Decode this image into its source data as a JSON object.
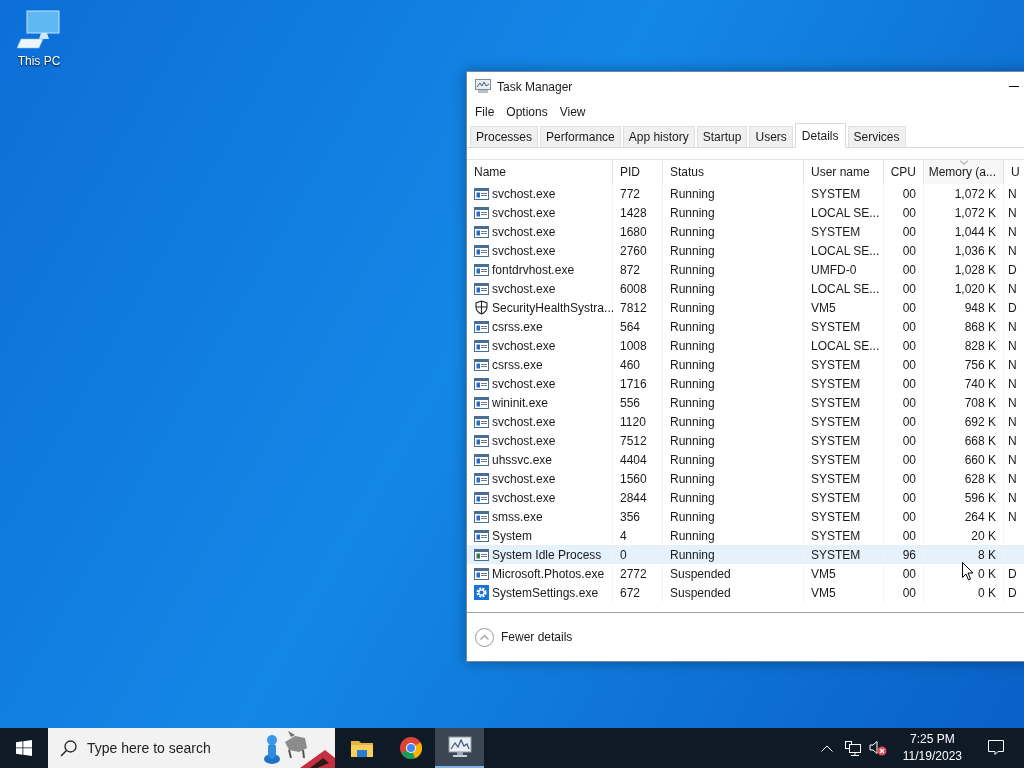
{
  "desktop": {
    "icons": [
      {
        "label": "This PC"
      }
    ]
  },
  "window": {
    "title": "Task Manager",
    "menu": [
      "File",
      "Options",
      "View"
    ],
    "tabs": [
      {
        "label": "Processes",
        "selected": false
      },
      {
        "label": "Performance",
        "selected": false
      },
      {
        "label": "App history",
        "selected": false
      },
      {
        "label": "Startup",
        "selected": false
      },
      {
        "label": "Users",
        "selected": false
      },
      {
        "label": "Details",
        "selected": true
      },
      {
        "label": "Services",
        "selected": false
      }
    ],
    "table": {
      "columns": [
        {
          "label": "Name",
          "sorted": false
        },
        {
          "label": "PID",
          "sorted": false
        },
        {
          "label": "Status",
          "sorted": false
        },
        {
          "label": "User name",
          "sorted": false
        },
        {
          "label": "CPU",
          "sorted": false
        },
        {
          "label": "Memory (a...",
          "sorted": true
        },
        {
          "label": "U",
          "sorted": false
        }
      ],
      "rows": [
        {
          "kind": "app",
          "selected": false,
          "cells": [
            "svchost.exe",
            "772",
            "Running",
            "SYSTEM",
            "00",
            "1,072 K",
            "N"
          ]
        },
        {
          "kind": "app",
          "selected": false,
          "cells": [
            "svchost.exe",
            "1428",
            "Running",
            "LOCAL SE...",
            "00",
            "1,072 K",
            "N"
          ]
        },
        {
          "kind": "app",
          "selected": false,
          "cells": [
            "svchost.exe",
            "1680",
            "Running",
            "SYSTEM",
            "00",
            "1,044 K",
            "N"
          ]
        },
        {
          "kind": "app",
          "selected": false,
          "cells": [
            "svchost.exe",
            "2760",
            "Running",
            "LOCAL SE...",
            "00",
            "1,036 K",
            "N"
          ]
        },
        {
          "kind": "app",
          "selected": false,
          "cells": [
            "fontdrvhost.exe",
            "872",
            "Running",
            "UMFD-0",
            "00",
            "1,028 K",
            "D"
          ]
        },
        {
          "kind": "app",
          "selected": false,
          "cells": [
            "svchost.exe",
            "6008",
            "Running",
            "LOCAL SE...",
            "00",
            "1,020 K",
            "N"
          ]
        },
        {
          "kind": "shield",
          "selected": false,
          "cells": [
            "SecurityHealthSystra...",
            "7812",
            "Running",
            "VM5",
            "00",
            "948 K",
            "D"
          ]
        },
        {
          "kind": "app",
          "selected": false,
          "cells": [
            "csrss.exe",
            "564",
            "Running",
            "SYSTEM",
            "00",
            "868 K",
            "N"
          ]
        },
        {
          "kind": "app",
          "selected": false,
          "cells": [
            "svchost.exe",
            "1008",
            "Running",
            "LOCAL SE...",
            "00",
            "828 K",
            "N"
          ]
        },
        {
          "kind": "app",
          "selected": false,
          "cells": [
            "csrss.exe",
            "460",
            "Running",
            "SYSTEM",
            "00",
            "756 K",
            "N"
          ]
        },
        {
          "kind": "app",
          "selected": false,
          "cells": [
            "svchost.exe",
            "1716",
            "Running",
            "SYSTEM",
            "00",
            "740 K",
            "N"
          ]
        },
        {
          "kind": "app",
          "selected": false,
          "cells": [
            "wininit.exe",
            "556",
            "Running",
            "SYSTEM",
            "00",
            "708 K",
            "N"
          ]
        },
        {
          "kind": "app",
          "selected": false,
          "cells": [
            "svchost.exe",
            "1120",
            "Running",
            "SYSTEM",
            "00",
            "692 K",
            "N"
          ]
        },
        {
          "kind": "app",
          "selected": false,
          "cells": [
            "svchost.exe",
            "7512",
            "Running",
            "SYSTEM",
            "00",
            "668 K",
            "N"
          ]
        },
        {
          "kind": "app",
          "selected": false,
          "cells": [
            "uhssvc.exe",
            "4404",
            "Running",
            "SYSTEM",
            "00",
            "660 K",
            "N"
          ]
        },
        {
          "kind": "app",
          "selected": false,
          "cells": [
            "svchost.exe",
            "1560",
            "Running",
            "SYSTEM",
            "00",
            "628 K",
            "N"
          ]
        },
        {
          "kind": "app",
          "selected": false,
          "cells": [
            "svchost.exe",
            "2844",
            "Running",
            "SYSTEM",
            "00",
            "596 K",
            "N"
          ]
        },
        {
          "kind": "app",
          "selected": false,
          "cells": [
            "smss.exe",
            "356",
            "Running",
            "SYSTEM",
            "00",
            "264 K",
            "N"
          ]
        },
        {
          "kind": "app",
          "selected": false,
          "cells": [
            "System",
            "4",
            "Running",
            "SYSTEM",
            "00",
            "20 K",
            ""
          ]
        },
        {
          "kind": "idle",
          "selected": true,
          "cells": [
            "System Idle Process",
            "0",
            "Running",
            "SYSTEM",
            "96",
            "8 K",
            ""
          ]
        },
        {
          "kind": "app",
          "selected": false,
          "cells": [
            "Microsoft.Photos.exe",
            "2772",
            "Suspended",
            "VM5",
            "00",
            "0 K",
            "D"
          ]
        },
        {
          "kind": "gear",
          "selected": false,
          "cells": [
            "SystemSettings.exe",
            "672",
            "Suspended",
            "VM5",
            "00",
            "0 K",
            "D"
          ]
        }
      ]
    },
    "footer": {
      "button": "Fewer details"
    }
  },
  "taskbar": {
    "search": {
      "placeholder": "Type here to search"
    },
    "apps": [
      {
        "kind": "folder",
        "active": false
      },
      {
        "kind": "browser",
        "active": false
      },
      {
        "kind": "monitor",
        "active": true
      }
    ],
    "tray": {
      "volume_muted": true,
      "clock": {
        "time": "7:25 PM",
        "date": "11/19/2023"
      }
    }
  }
}
